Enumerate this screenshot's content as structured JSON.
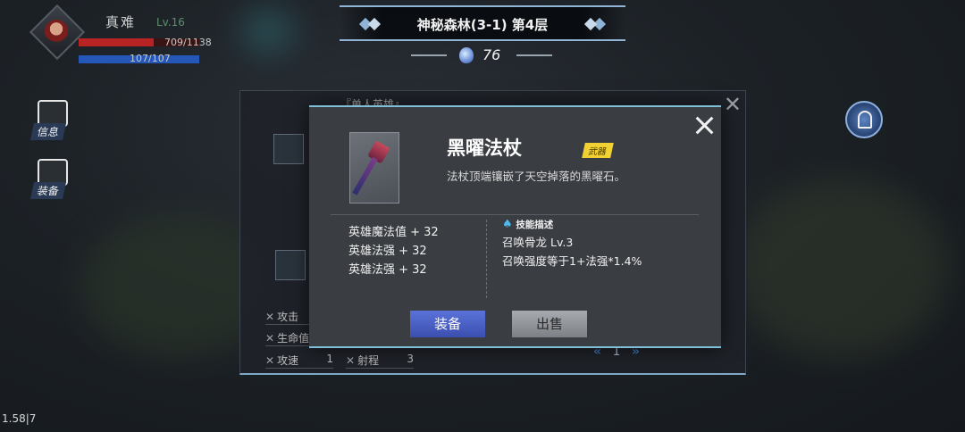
{
  "player": {
    "name": "真难",
    "level": "Lv.16",
    "hp_text": "709/1138",
    "hp_fraction": 0.623,
    "mp_text": "107/107",
    "mp_fraction": 1.0
  },
  "banner": {
    "title": "神秘森林(3-1)  第4层"
  },
  "currency": {
    "value": "76",
    "icon": "gem-icon"
  },
  "sidebar": {
    "info_label": "信息",
    "equip_label": "装备"
  },
  "background_panel": {
    "title": "『单人英雄』",
    "stats": [
      {
        "label": "攻击",
        "value": ""
      },
      {
        "label": "生命值",
        "value": ""
      },
      {
        "label": "攻速",
        "value": "1"
      },
      {
        "label": "射程",
        "value": "3"
      }
    ],
    "page": "1"
  },
  "item": {
    "name": "黑曜法杖",
    "tag": "武器",
    "description": "法杖顶端镶嵌了天空掉落的黑曜石。",
    "stats": [
      "英雄魔法值 + 32",
      "英雄法强 + 32",
      "英雄法强 + 32"
    ],
    "skill_title": "技能描述",
    "skill_lines": [
      "召唤骨龙 Lv.3",
      "召唤强度等于1+法强*1.4%"
    ],
    "equip_label": "装备",
    "sell_label": "出售"
  },
  "fps_text": "1.58|7",
  "colors": {
    "accent": "#7fc0d8",
    "equip_button": "#4a62c8",
    "tag_yellow": "#f2d233",
    "hp_red": "#b82424",
    "mp_blue": "#2457b8"
  }
}
